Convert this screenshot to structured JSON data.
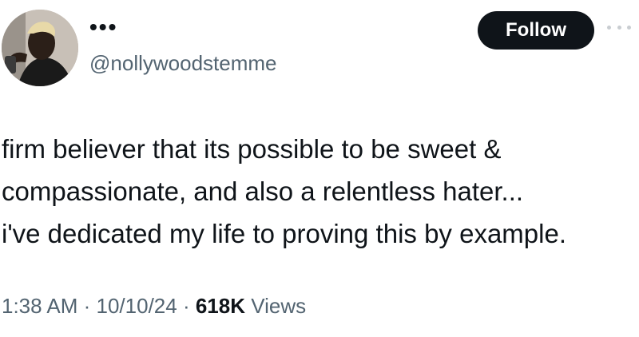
{
  "tweet": {
    "author": {
      "display_name": "•••",
      "handle": "@nollywoodstemme",
      "avatar_icon": "profile-avatar"
    },
    "follow_label": "Follow",
    "more_icon": "more-options-icon",
    "lines": [
      "firm believer that its possible to be sweet &",
      "compassionate, and also a relentless hater...",
      "i've dedicated my life to proving this by example."
    ],
    "meta": {
      "time": "1:38 AM",
      "separator": " · ",
      "date": "10/10/24",
      "views_count": "618K",
      "views_label": " Views"
    }
  },
  "colors": {
    "text": "#0f1419",
    "secondary": "#536471",
    "button_bg": "#0f1419",
    "button_text": "#ffffff"
  }
}
